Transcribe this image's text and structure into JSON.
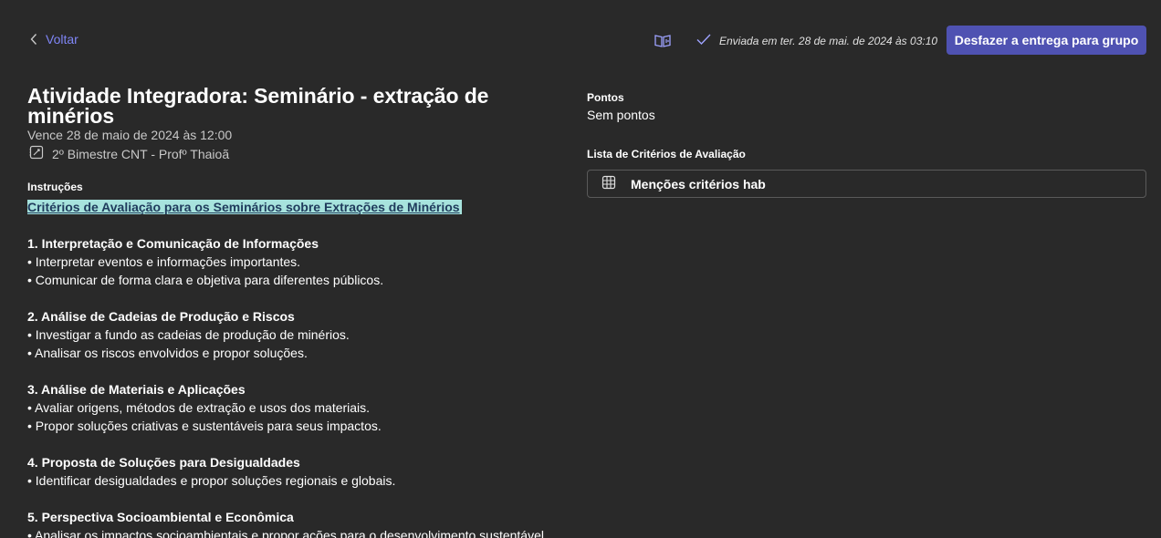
{
  "header": {
    "back_label": "Voltar",
    "sent_status": "Enviada em ter. 28 de mai. de 2024 às 03:10",
    "undo_button_label": "Desfazer a entrega para grupo"
  },
  "assignment": {
    "title": "Atividade Integradora: Seminário - extração de minérios",
    "due": "Vence 28 de maio de 2024 às 12:00",
    "class_name": "2º Bimestre CNT - Profº Thaioã",
    "instructions_label": "Instruções",
    "instructions_link": "Critérios de Avaliação para os Seminários sobre Extrações de Minérios",
    "lines": [
      "",
      "1. Interpretação e Comunicação de Informações",
      " • Interpretar eventos e informações importantes.",
      " • Comunicar de forma clara e objetiva para diferentes públicos.",
      "",
      " 2. Análise de Cadeias de Produção e Riscos",
      "• Investigar a fundo as cadeias de produção de minérios.",
      "• Analisar os riscos envolvidos e propor soluções.",
      "",
      "3. Análise de Materiais e Aplicações",
      "• Avaliar origens, métodos de extração e usos dos materiais.",
      "• Propor soluções criativas e sustentáveis para seus impactos.",
      "",
      "4. Proposta de Soluções para Desigualdades",
      "• Identificar desigualdades e propor soluções regionais e globais.",
      "",
      "5. Perspectiva Socioambiental e Econômica",
      "• Analisar os impactos socioambientais e propor ações para o desenvolvimento sustentável."
    ]
  },
  "sidebar": {
    "points_label": "Pontos",
    "points_value": "Sem pontos",
    "rubric_label": "Lista de Critérios de Avaliação",
    "rubric_name": "Menções critérios hab"
  },
  "icons": {
    "back": "chevron-left-icon",
    "reader": "immersive-reader-icon",
    "sent": "checkmark-icon",
    "class": "class-notebook-icon",
    "rubric": "grid-table-icon"
  },
  "colors": {
    "background": "#292929",
    "accent": "#4f52b2",
    "link": "#7f85f5",
    "highlight": "#a7e3dd"
  }
}
